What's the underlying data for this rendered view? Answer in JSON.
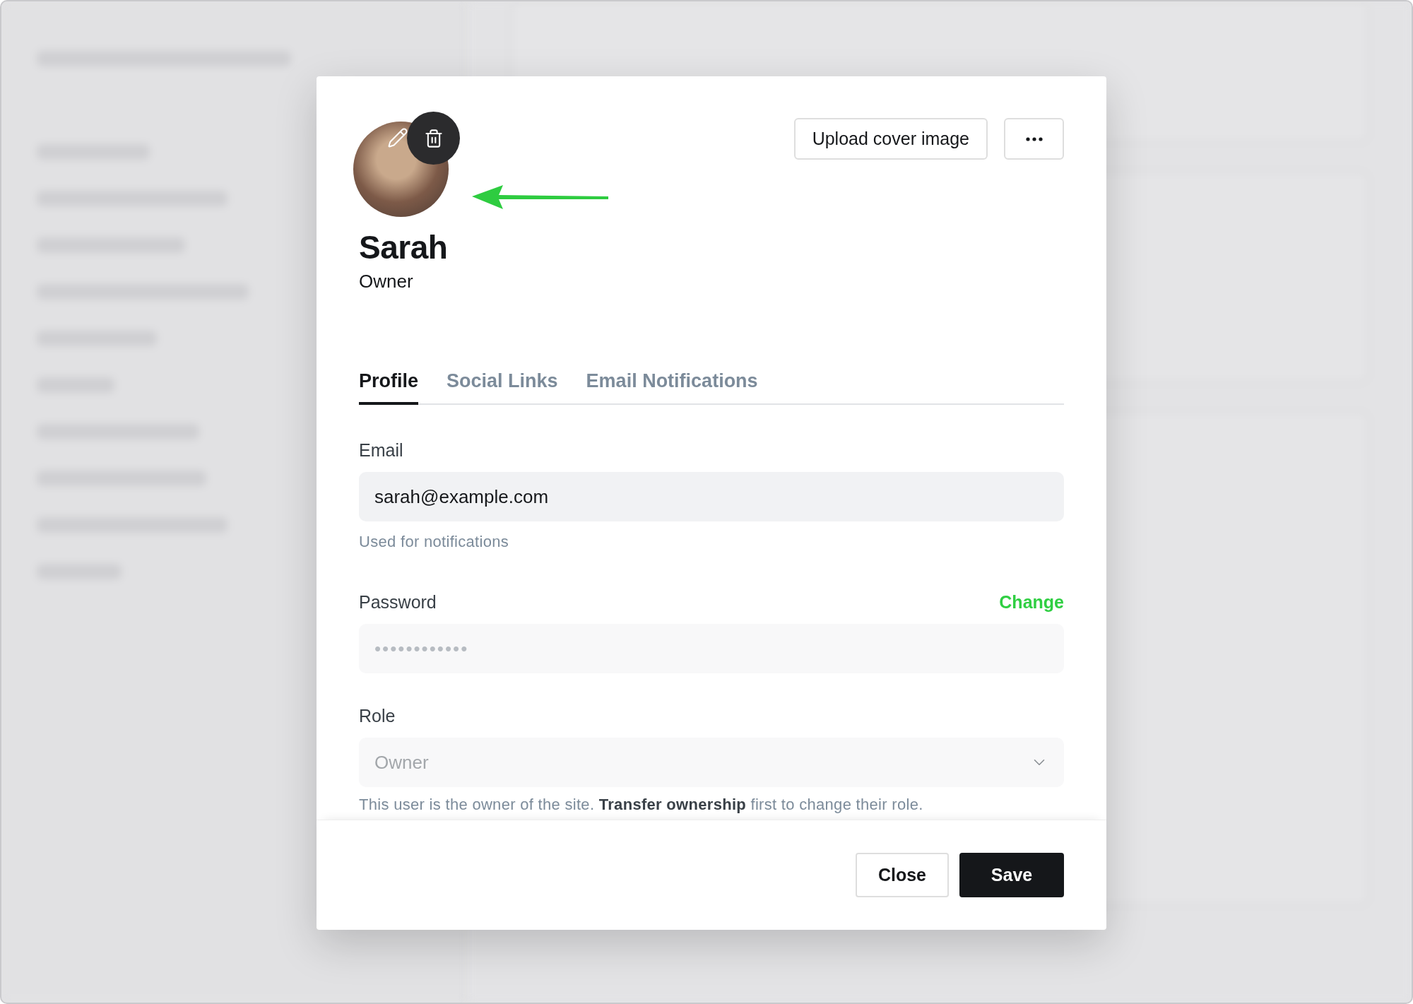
{
  "header": {
    "upload_button": "Upload cover image"
  },
  "profile": {
    "name": "Sarah",
    "role": "Owner"
  },
  "tabs": [
    {
      "label": "Profile",
      "selected": true
    },
    {
      "label": "Social Links",
      "selected": false
    },
    {
      "label": "Email Notifications",
      "selected": false
    }
  ],
  "email": {
    "label": "Email",
    "value": "sarah@example.com",
    "hint": "Used for notifications"
  },
  "password": {
    "label": "Password",
    "action": "Change",
    "placeholder": "••••••••••••"
  },
  "role": {
    "label": "Role",
    "value": "Owner",
    "disabled": true,
    "help": "This user is the owner of the site. **Transfer ownership** first to change their role."
  },
  "footer_buttons": [
    {
      "label": "Close",
      "kind": "secondary"
    },
    {
      "label": "Save",
      "kind": "primary"
    }
  ]
}
